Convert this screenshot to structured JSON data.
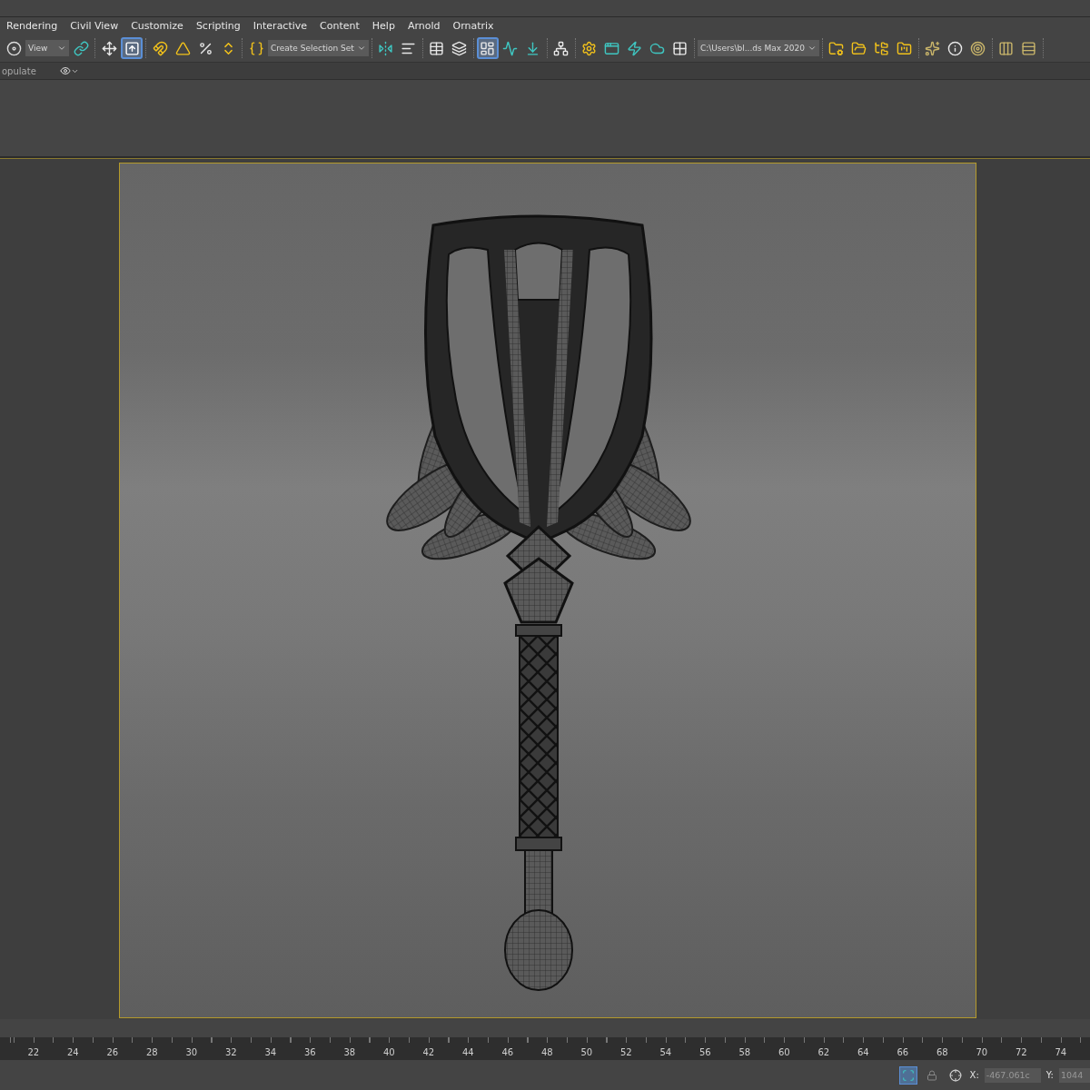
{
  "menu_bar": [
    "Rendering",
    "Civil View",
    "Customize",
    "Scripting",
    "Interactive",
    "Content",
    "Help",
    "Arnold",
    "Ornatrix"
  ],
  "toolbar": [
    {
      "items": [
        {
          "kind": "tool",
          "selected": false
        },
        {
          "kind": "dropdown",
          "value": "View"
        },
        {
          "kind": "tool",
          "selected": false
        }
      ]
    },
    {
      "items": [
        {
          "kind": "tool",
          "selected": false
        },
        {
          "kind": "tool",
          "selected": true
        }
      ]
    },
    {
      "items": [
        {
          "kind": "tool",
          "selected": false
        },
        {
          "kind": "tool",
          "selected": false
        },
        {
          "kind": "tool",
          "selected": false
        },
        {
          "kind": "tool",
          "selected": false
        }
      ]
    },
    {
      "items": [
        {
          "kind": "tool",
          "selected": false
        },
        {
          "kind": "dropdown",
          "value": "Create Selection Set"
        }
      ]
    },
    {
      "items": [
        {
          "kind": "tool",
          "selected": false
        },
        {
          "kind": "tool",
          "selected": false
        }
      ]
    },
    {
      "items": [
        {
          "kind": "tool",
          "selected": false
        },
        {
          "kind": "tool",
          "selected": false
        }
      ]
    },
    {
      "items": [
        {
          "kind": "tool",
          "selected": true
        },
        {
          "kind": "tool",
          "selected": false
        },
        {
          "kind": "tool",
          "selected": false
        }
      ]
    },
    {
      "items": [
        {
          "kind": "tool",
          "selected": false
        }
      ]
    },
    {
      "items": [
        {
          "kind": "tool",
          "selected": false
        },
        {
          "kind": "tool",
          "selected": false
        },
        {
          "kind": "tool",
          "selected": false
        },
        {
          "kind": "tool",
          "selected": false
        },
        {
          "kind": "tool",
          "selected": false
        }
      ]
    },
    {
      "items": [
        {
          "kind": "dropdown",
          "value": "C:\\Users\\bl...ds Max 2020"
        }
      ]
    },
    {
      "items": [
        {
          "kind": "tool",
          "selected": false
        },
        {
          "kind": "tool",
          "selected": false
        },
        {
          "kind": "tool",
          "selected": false
        },
        {
          "kind": "tool",
          "selected": false
        }
      ]
    },
    {
      "items": [
        {
          "kind": "tool",
          "selected": false
        },
        {
          "kind": "tool",
          "selected": false
        },
        {
          "kind": "tool",
          "selected": false
        }
      ]
    },
    {
      "items": [
        {
          "kind": "tool",
          "selected": false
        },
        {
          "kind": "tool",
          "selected": false
        }
      ]
    }
  ],
  "ribbon": {
    "tab": "opulate"
  },
  "timeline": {
    "ticks": [
      "22",
      "24",
      "26",
      "28",
      "30",
      "32",
      "34",
      "36",
      "38",
      "40",
      "42",
      "44",
      "46",
      "48",
      "50",
      "52",
      "54",
      "56",
      "58",
      "60",
      "62",
      "64",
      "66",
      "68",
      "70",
      "72",
      "74"
    ]
  },
  "status_bar": {
    "x_label": "X:",
    "x_value": "-467.061c",
    "y_label": "Y:",
    "y_value": "1044"
  }
}
